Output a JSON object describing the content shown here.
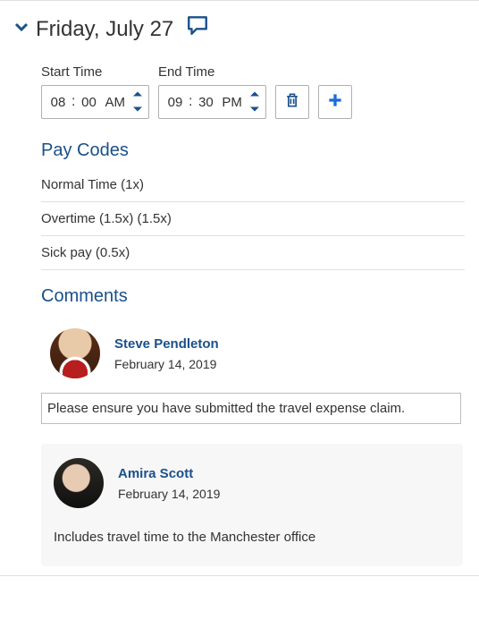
{
  "header": {
    "day_title": "Friday, July 27"
  },
  "time": {
    "start_label": "Start Time",
    "end_label": "End Time",
    "start": {
      "hour": "08",
      "minute": "00",
      "ampm": "AM"
    },
    "end": {
      "hour": "09",
      "minute": "30",
      "ampm": "PM"
    }
  },
  "paycodes": {
    "heading": "Pay Codes",
    "items": [
      "Normal Time (1x)",
      "Overtime (1.5x) (1.5x)",
      "Sick pay (0.5x)"
    ]
  },
  "comments": {
    "heading": "Comments",
    "entries": [
      {
        "author": "Steve Pendleton",
        "date": "February 14, 2019",
        "body": "Please ensure you have submitted the travel expense claim."
      },
      {
        "author": "Amira Scott",
        "date": "February 14, 2019",
        "body": "Includes travel time to the Manchester office"
      }
    ]
  },
  "icons": {
    "delete": "trash-icon",
    "add": "plus-icon",
    "collapse": "chevron-down-icon",
    "comment": "comment-icon"
  }
}
